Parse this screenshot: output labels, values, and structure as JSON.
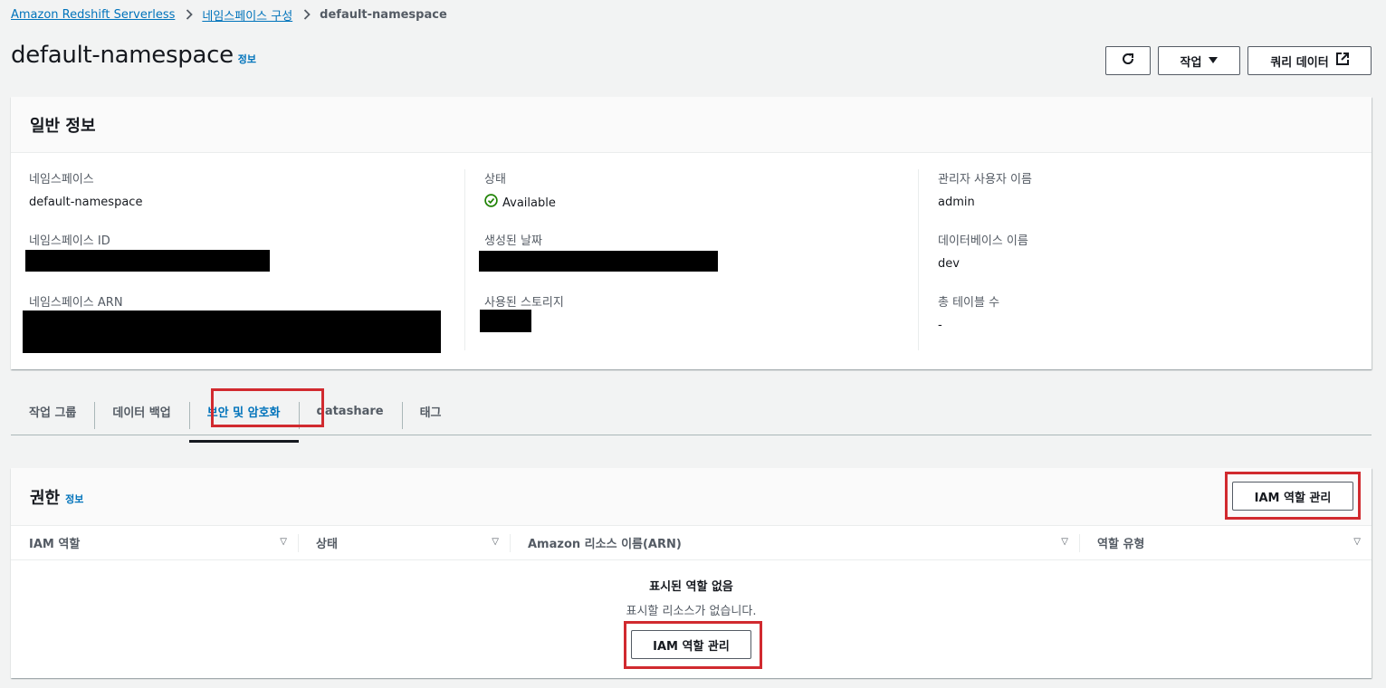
{
  "breadcrumb": {
    "items": [
      "Amazon Redshift Serverless",
      "네임스페이스 구성"
    ],
    "current": "default-namespace"
  },
  "page": {
    "title": "default-namespace",
    "info_label": "정보"
  },
  "header_actions": {
    "actions_label": "작업",
    "query_label": "쿼리 데이터"
  },
  "general": {
    "heading": "일반 정보",
    "fields": {
      "namespace": {
        "label": "네임스페이스",
        "value": "default-namespace"
      },
      "namespace_id": {
        "label": "네임스페이스 ID"
      },
      "namespace_arn": {
        "label": "네임스페이스 ARN"
      },
      "status": {
        "label": "상태",
        "value": "Available"
      },
      "created": {
        "label": "생성된 날짜"
      },
      "storage": {
        "label": "사용된 스토리지"
      },
      "admin_user": {
        "label": "관리자 사용자 이름",
        "value": "admin"
      },
      "database": {
        "label": "데이터베이스 이름",
        "value": "dev"
      },
      "table_count": {
        "label": "총 테이블 수",
        "value": "-"
      }
    }
  },
  "tabs": [
    "작업 그룹",
    "데이터 백업",
    "보안 및 암호화",
    "datashare",
    "태그"
  ],
  "permissions": {
    "heading": "권한",
    "info_label": "정보",
    "manage_button": "IAM 역할 관리",
    "columns": [
      "IAM 역할",
      "상태",
      "Amazon 리소스 이름(ARN)",
      "역할 유형"
    ],
    "empty_title": "표시된 역할 없음",
    "empty_subtitle": "표시할 리소스가 없습니다.",
    "empty_button": "IAM 역할 관리"
  },
  "colors": {
    "link": "#0073bb",
    "success": "#1d8102",
    "highlight": "#d12a2f"
  }
}
